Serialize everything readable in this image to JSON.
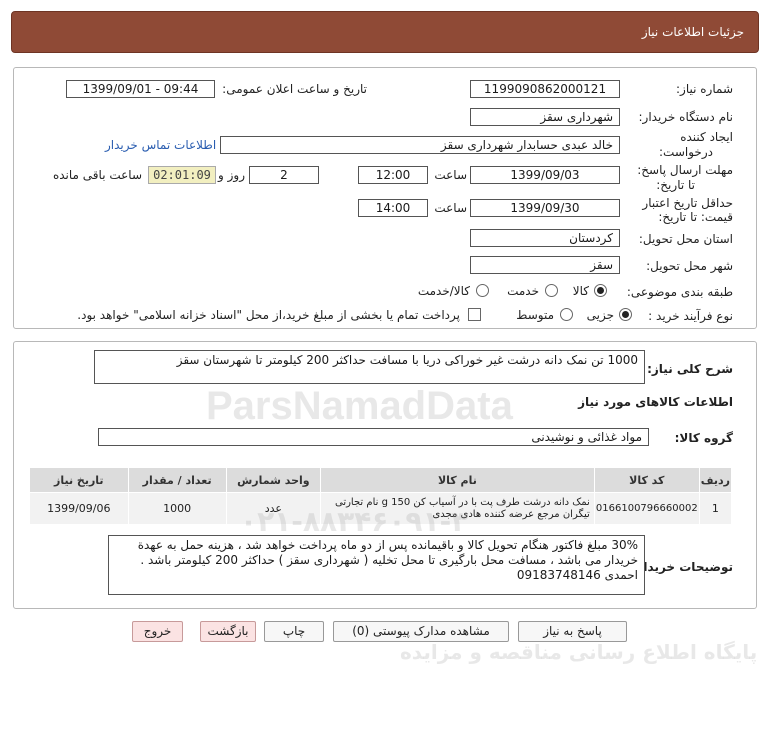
{
  "header": {
    "title": "جزئیات اطلاعات نیاز"
  },
  "form": {
    "need_number_label": "شماره نیاز:",
    "need_number": "1199090862000121",
    "announce_label": "تاریخ و ساعت اعلان عمومی:",
    "announce_value": "1399/09/01 - 09:44",
    "buyer_org_label": "نام دستگاه خریدار:",
    "buyer_org": "شهرداری سقز",
    "creator_label_1": "ایجاد کننده",
    "creator_label_2": "درخواست:",
    "creator": "خالد عبدی حسابدار شهرداری سقز",
    "contact_link": "اطلاعات تماس خریدار",
    "reply_label_1": "مهلت ارسال پاسخ:",
    "reply_label_2": "تا تاریخ:",
    "reply_date": "1399/09/03",
    "time_label": "ساعت",
    "reply_time": "12:00",
    "days_value": "2",
    "days_label": "روز و",
    "remaining_time": "02:01:09",
    "remaining_label": "ساعت باقی مانده",
    "validity_label_1": "حداقل تاریخ اعتبار",
    "validity_label_2": "قیمت: تا تاریخ:",
    "validity_date": "1399/09/30",
    "validity_time": "14:00",
    "province_label": "استان محل تحویل:",
    "province": "کردستان",
    "city_label": "شهر محل تحویل:",
    "city": "سقز",
    "category_label": "طبقه بندی موضوعی:",
    "category_options": [
      "کالا",
      "خدمت",
      "کالا/خدمت"
    ],
    "purchase_label": "نوع فرآیند خرید :",
    "purchase_options": [
      "جزیی",
      "متوسط"
    ],
    "payment_note": "پرداخت تمام یا بخشی از مبلغ خرید،از محل \"اسناد خزانه اسلامی\" خواهد بود."
  },
  "details": {
    "summary_label": "شرح کلی نیاز:",
    "summary": "1000 تن نمک دانه درشت غیر خوراکی دریا با مسافت حداکثر 200 کیلومتر تا شهرستان سقز",
    "goods_info_title": "اطلاعات کالاهای مورد نیاز",
    "group_label": "گروه کالا:",
    "group_value": "مواد غذائی و نوشیدنی",
    "table": {
      "headers": [
        "ردیف",
        "کد کالا",
        "نام کالا",
        "واحد شمارش",
        "تعداد / مقدار",
        "تاریخ نیاز"
      ],
      "rows": [
        [
          "1",
          "0166100796660002",
          "نمک دانه درشت طرف پت با در آسیاب کن 150 g نام تجارتی تیگران مرجع عرضه کننده هادی مجدی",
          "عدد",
          "1000",
          "1399/09/06"
        ]
      ]
    },
    "buyer_notes_label": "توضیحات خریدار:",
    "buyer_notes": "30% مبلغ فاکتور هنگام تحویل کالا و باقیمانده پس از دو ماه پرداخت خواهد شد ، هزینه حمل به عهدة خریدار می باشد ، مسافت محل بارگیری تا محل تخلیه ( شهرداری سقز ) حداکثر 200 کیلومتر باشد . احمدی 09183748146"
  },
  "buttons": {
    "reply": "پاسخ به نیاز",
    "attachments": "مشاهده مدارک پیوستی (0)",
    "print": "چاپ",
    "back": "بازگشت",
    "exit": "خروج"
  },
  "watermark": {
    "brand": "ParsNamadData",
    "line1": "پایگاه اطلاع رسانی مناقصه و مزایده",
    "line2": "۰۲۱-۸۸۳۴۶۰۹۱-۳"
  }
}
